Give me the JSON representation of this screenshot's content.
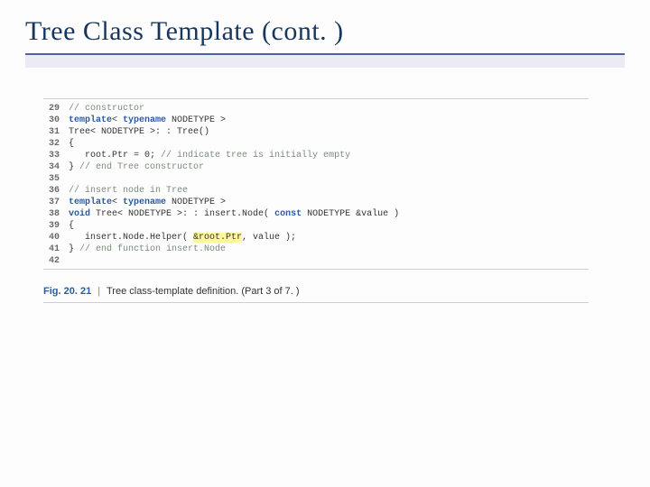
{
  "title": "Tree Class Template (cont. )",
  "code": {
    "lines": [
      {
        "n": "29",
        "frags": [
          {
            "t": "// constructor",
            "c": "cmt"
          }
        ]
      },
      {
        "n": "30",
        "frags": [
          {
            "t": "template",
            "c": "kw"
          },
          {
            "t": "< ",
            "c": "op"
          },
          {
            "t": "typename",
            "c": "kw"
          },
          {
            "t": " NODETYPE >",
            "c": "op"
          }
        ]
      },
      {
        "n": "31",
        "frags": [
          {
            "t": "Tree< NODETYPE >: : Tree()",
            "c": "op"
          }
        ]
      },
      {
        "n": "32",
        "frags": [
          {
            "t": "{",
            "c": "op"
          }
        ]
      },
      {
        "n": "33",
        "frags": [
          {
            "t": "   root.Ptr = 0; ",
            "c": "op"
          },
          {
            "t": "// indicate tree is initially empty",
            "c": "cmt"
          }
        ]
      },
      {
        "n": "34",
        "frags": [
          {
            "t": "} ",
            "c": "op"
          },
          {
            "t": "// end Tree constructor",
            "c": "cmt"
          }
        ]
      },
      {
        "n": "35",
        "frags": [
          {
            "t": "",
            "c": "op"
          }
        ]
      },
      {
        "n": "36",
        "frags": [
          {
            "t": "// insert node in Tree",
            "c": "cmt"
          }
        ]
      },
      {
        "n": "37",
        "frags": [
          {
            "t": "template",
            "c": "kw"
          },
          {
            "t": "< ",
            "c": "op"
          },
          {
            "t": "typename",
            "c": "kw"
          },
          {
            "t": " NODETYPE >",
            "c": "op"
          }
        ]
      },
      {
        "n": "38",
        "frags": [
          {
            "t": "void",
            "c": "kw"
          },
          {
            "t": " Tree< NODETYPE >: : insert.Node( ",
            "c": "op"
          },
          {
            "t": "const",
            "c": "kw"
          },
          {
            "t": " NODETYPE &value )",
            "c": "op"
          }
        ]
      },
      {
        "n": "39",
        "frags": [
          {
            "t": "{",
            "c": "op"
          }
        ]
      },
      {
        "n": "40",
        "frags": [
          {
            "t": "   insert.Node.Helper( ",
            "c": "op"
          },
          {
            "t": "&root.Ptr",
            "c": "hl"
          },
          {
            "t": ", value );",
            "c": "op"
          }
        ]
      },
      {
        "n": "41",
        "frags": [
          {
            "t": "} ",
            "c": "op"
          },
          {
            "t": "// end function insert.Node",
            "c": "cmt"
          }
        ]
      },
      {
        "n": "42",
        "frags": [
          {
            "t": "",
            "c": "op"
          }
        ]
      }
    ]
  },
  "caption": {
    "fig": "Fig. 20. 21",
    "sep": "|",
    "text": "Tree class-template definition. (Part 3 of 7. )"
  }
}
